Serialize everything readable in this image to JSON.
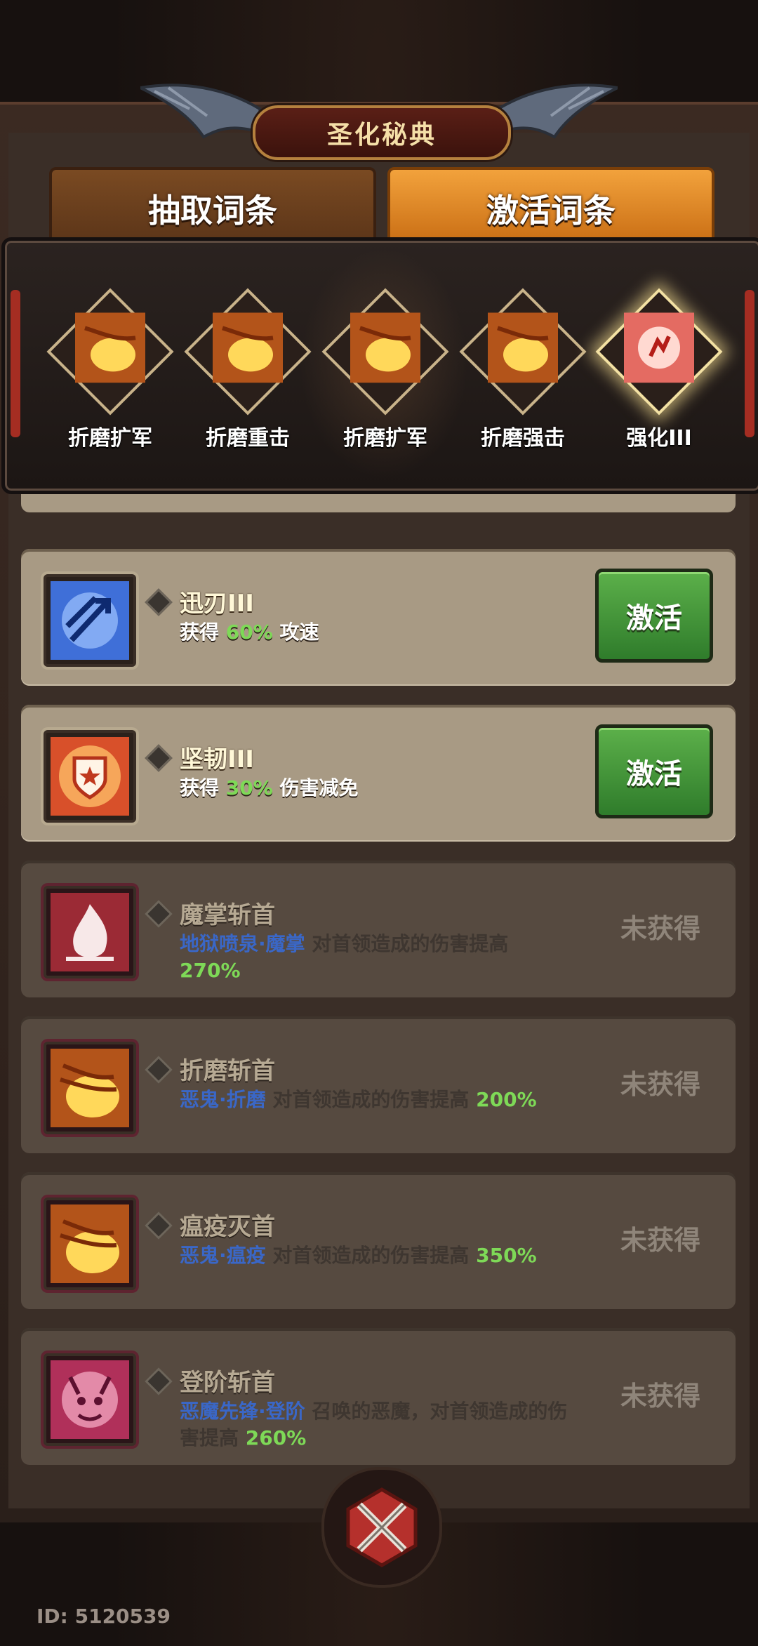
{
  "title": "圣化秘典",
  "tabs": [
    {
      "label": "抽取词条",
      "active": false
    },
    {
      "label": "激活词条",
      "active": true
    }
  ],
  "equipped": [
    {
      "label": "折磨扩军",
      "icon": "fire-claw-icon"
    },
    {
      "label": "折磨重击",
      "icon": "fire-claw-icon"
    },
    {
      "label": "折磨扩军",
      "icon": "fire-claw-icon"
    },
    {
      "label": "折磨强击",
      "icon": "fire-claw-icon"
    },
    {
      "label": "强化III",
      "icon": "red-burst-icon"
    }
  ],
  "entries": [
    {
      "title": "迅刃III",
      "desc_pre": "获得",
      "value": "60%",
      "desc_post": "攻速",
      "button": "激活",
      "icon": "blue-arrows-icon",
      "locked": false
    },
    {
      "title": "坚韧III",
      "desc_pre": "获得",
      "value": "30%",
      "desc_post": "伤害减免",
      "button": "激活",
      "icon": "star-shield-icon",
      "locked": false
    },
    {
      "title": "魔掌斩首",
      "tag": "地狱喷泉·魔掌",
      "desc": "对首领造成的伤害提高",
      "value": "270%",
      "status": "未获得",
      "icon": "white-flame-icon",
      "locked": true
    },
    {
      "title": "折磨斩首",
      "tag": "恶鬼·折磨",
      "desc": "对首领造成的伤害提高",
      "value": "200%",
      "status": "未获得",
      "icon": "fire-claw-icon",
      "locked": true
    },
    {
      "title": "瘟疫灭首",
      "tag": "恶鬼·瘟疫",
      "desc": "对首领造成的伤害提高",
      "value": "350%",
      "status": "未获得",
      "icon": "fire-claw-icon",
      "locked": true
    },
    {
      "title": "登阶斩首",
      "tag": "恶魔先锋·登阶",
      "desc": "召唤的恶魔，对首领造成的伤害提高",
      "value": "260%",
      "status": "未获得",
      "icon": "demon-face-icon",
      "locked": true
    }
  ],
  "footer": {
    "id_label": "ID: 5120539",
    "emblem_icon": "crossed-swords-icon"
  },
  "colors": {
    "accent_green": "#7ed957",
    "tag_blue": "#3a67c7",
    "button_green": "#3f9a35",
    "tab_orange": "#e08a25"
  }
}
